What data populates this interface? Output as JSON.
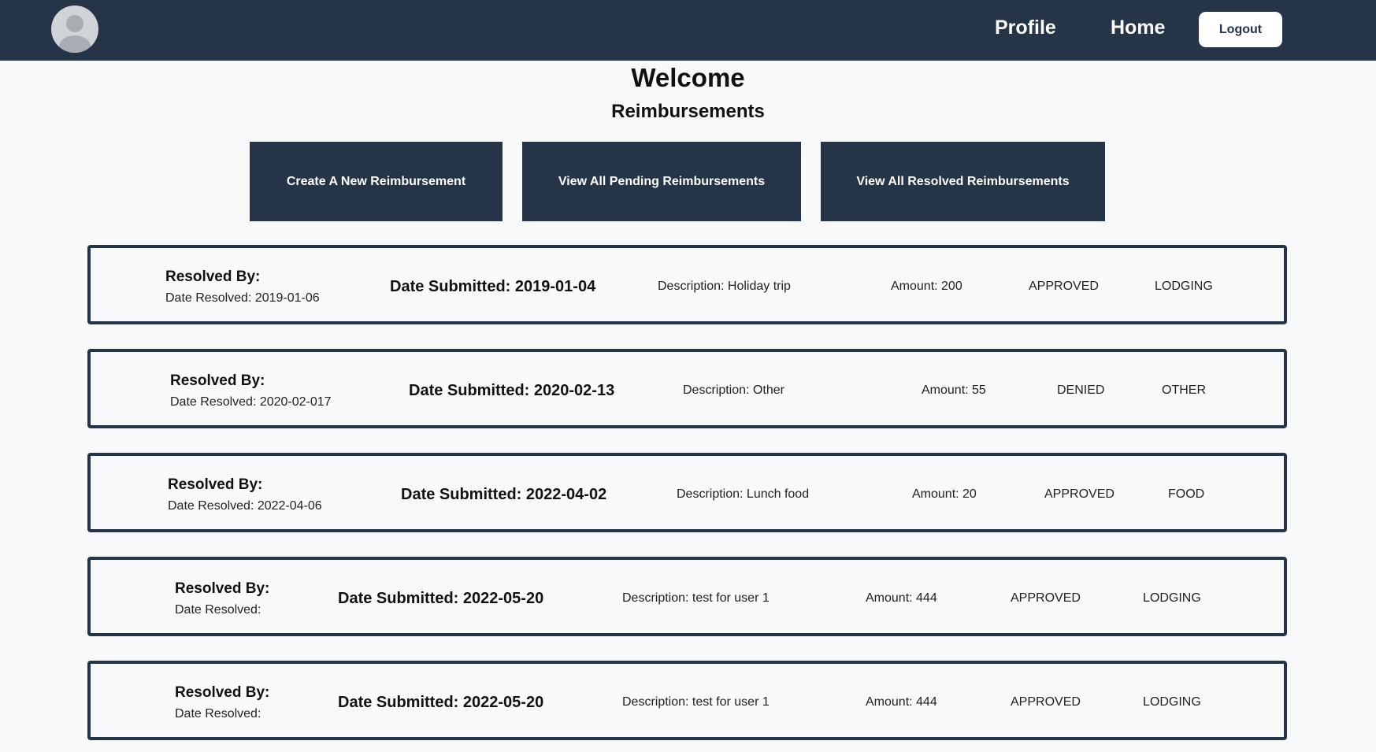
{
  "nav": {
    "profile_label": "Profile",
    "home_label": "Home",
    "logout_label": "Logout"
  },
  "main": {
    "title": "Welcome",
    "subtitle": "Reimbursements",
    "buttons": {
      "create": "Create A New Reimbursement",
      "pending": "View All Pending Reimbursements",
      "resolved": "View All Resolved Reimbursements"
    }
  },
  "reimbursements": [
    {
      "resolved_by": "Resolved By:",
      "date_resolved": "Date Resolved: 2019-01-06",
      "date_submitted": "Date Submitted: 2019-01-04",
      "description": "Description: Holiday trip",
      "amount": "Amount: 200",
      "status": "APPROVED",
      "type": "LODGING"
    },
    {
      "resolved_by": "Resolved By:",
      "date_resolved": "Date Resolved: 2020-02-017",
      "date_submitted": "Date Submitted: 2020-02-13",
      "description": "Description: Other",
      "amount": "Amount: 55",
      "status": "DENIED",
      "type": "OTHER"
    },
    {
      "resolved_by": "Resolved By:",
      "date_resolved": "Date Resolved: 2022-04-06",
      "date_submitted": "Date Submitted: 2022-04-02",
      "description": "Description: Lunch food",
      "amount": "Amount: 20",
      "status": "APPROVED",
      "type": "FOOD"
    },
    {
      "resolved_by": "Resolved By:",
      "date_resolved": "Date Resolved:",
      "date_submitted": "Date Submitted: 2022-05-20",
      "description": "Description: test for user 1",
      "amount": "Amount: 444",
      "status": "APPROVED",
      "type": "LODGING"
    },
    {
      "resolved_by": "Resolved By:",
      "date_resolved": "Date Resolved:",
      "date_submitted": "Date Submitted: 2022-05-20",
      "description": "Description: test for user 1",
      "amount": "Amount: 444",
      "status": "APPROVED",
      "type": "LODGING"
    }
  ]
}
